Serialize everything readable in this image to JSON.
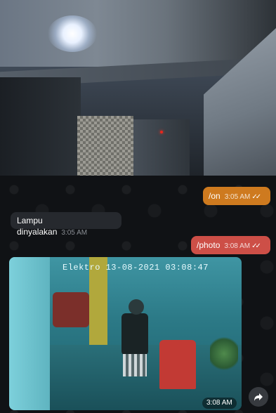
{
  "photo_top": {
    "description_icon": "video-stream-frame"
  },
  "chat": {
    "messages": [
      {
        "id": "on",
        "text": "/on",
        "time": "3:05 AM",
        "direction": "outgoing",
        "ticks": "✓✓",
        "color": "#ce7a1f"
      },
      {
        "id": "lampu",
        "text": "Lampu dinyalakan",
        "time": "3:05 AM",
        "direction": "incoming",
        "color": "#26292e"
      },
      {
        "id": "photo",
        "text": "/photo",
        "time": "3:08 AM",
        "direction": "outgoing",
        "ticks": "✓✓",
        "color": "#cd4f47"
      }
    ],
    "image_message": {
      "stamp": "Elektro 13-08-2021 03:08:47",
      "time": "3:08 AM",
      "share_icon": "share-arrow-icon"
    }
  }
}
